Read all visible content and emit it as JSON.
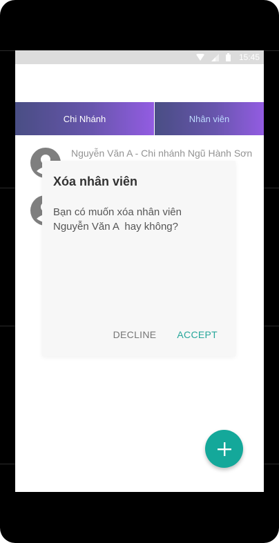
{
  "status_bar": {
    "time": "15:45",
    "icons": [
      "wifi-icon",
      "signal-icon",
      "battery-icon"
    ]
  },
  "tabs": [
    {
      "label": "Chi Nhánh"
    },
    {
      "label": "Nhân viên"
    }
  ],
  "employees": [
    {
      "text": "Nguyễn Văn A - Chi nhánh Ngũ Hành Sơn"
    },
    {
      "text": ""
    }
  ],
  "dialog": {
    "title": "Xóa nhân viên",
    "message_line_1": "Bạn có muốn xóa nhân viên",
    "message_line_2": "Nguyễn Văn A  hay không?",
    "decline_label": "DECLINE",
    "accept_label": "ACCEPT"
  },
  "fab": {
    "icon": "plus-icon"
  },
  "colors": {
    "tab_gradient_start": "#3a3f7a",
    "tab_gradient_end": "#8a4fe0",
    "accent": "#26a69a",
    "fab": "#14a89a"
  }
}
